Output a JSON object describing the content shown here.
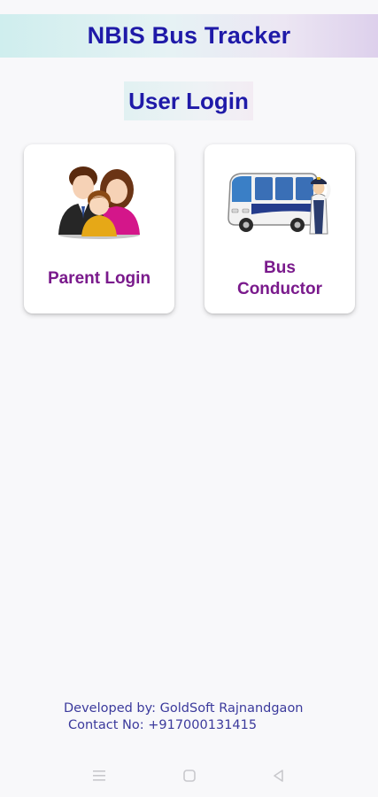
{
  "header": {
    "title": "NBIS Bus Tracker"
  },
  "section": {
    "title": "User Login"
  },
  "cards": [
    {
      "label": "Parent Login",
      "icon": "family-icon"
    },
    {
      "label": "Bus\nConductor",
      "icon": "bus-conductor-icon"
    }
  ],
  "footer": {
    "developed_by": "Developed by: GoldSoft Rajnandgaon",
    "contact": "Contact No: +917000131415"
  },
  "navbar": {
    "icons": [
      "menu-icon",
      "home-icon",
      "back-icon"
    ]
  },
  "colors": {
    "title": "#1f1aa8",
    "card_label": "#7a1a8c",
    "footer_text": "#3b3a9c",
    "background": "#f8f8fa"
  }
}
